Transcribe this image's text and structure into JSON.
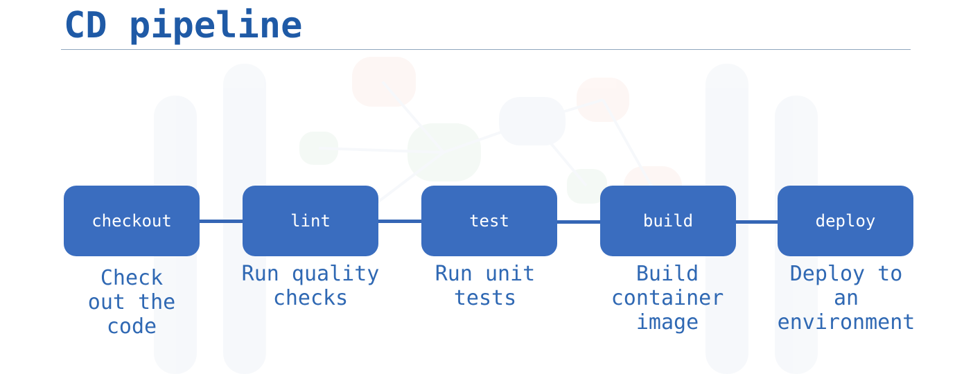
{
  "title": "CD pipeline",
  "colors": {
    "title": "#1f5aa6",
    "stage_fill": "#3a6dbf",
    "connector": "#3566b5",
    "description": "#2f68b3",
    "rule": "#8fa7bd"
  },
  "stages": [
    {
      "label": "checkout",
      "description_lines": [
        "Check",
        "out the",
        "code"
      ]
    },
    {
      "label": "lint",
      "description_lines": [
        "Run quality",
        "checks"
      ]
    },
    {
      "label": "test",
      "description_lines": [
        "Run unit",
        "tests"
      ]
    },
    {
      "label": "build",
      "description_lines": [
        "Build",
        "container",
        "image"
      ]
    },
    {
      "label": "deploy",
      "description_lines": [
        "Deploy to",
        "an",
        "environment"
      ]
    }
  ]
}
